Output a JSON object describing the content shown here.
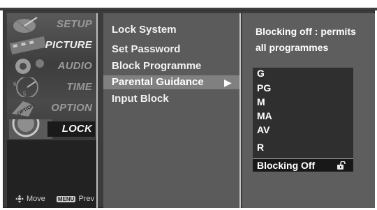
{
  "sidebar": {
    "items": [
      {
        "label": "SETUP",
        "icon": "satellite-dish-icon"
      },
      {
        "label": "PICTURE",
        "icon": "film-strip-icon"
      },
      {
        "label": "AUDIO",
        "icon": "speaker-icon"
      },
      {
        "label": "TIME",
        "icon": "clock-icon"
      },
      {
        "label": "OPTION",
        "icon": "option-icon"
      },
      {
        "label": "LOCK",
        "icon": "lock-dial-icon"
      }
    ],
    "active_index": 5
  },
  "footer": {
    "move_label": "Move",
    "menu_key": "MENU",
    "prev_label": "Prev"
  },
  "submenu": {
    "items": [
      {
        "label": "Lock System"
      },
      {
        "label": "Set Password"
      },
      {
        "label": "Block Programme"
      },
      {
        "label": "Parental Guidance"
      },
      {
        "label": "Input Block"
      }
    ],
    "selected_index": 3,
    "selected_arrow": "▶"
  },
  "panel": {
    "info_line1": "Blocking off : permits",
    "info_line2": "all programmes",
    "ratings": [
      "G",
      "PG",
      "M",
      "MA",
      "AV",
      "R"
    ],
    "blocking_option": "Blocking Off",
    "blocking_icon": "unlock-icon"
  },
  "colors": {
    "frame": "#3c3c3c",
    "sidebar_bg": "#222222",
    "submenu_bg": "#5b5b5b",
    "panel_bg": "#5e5e5e",
    "ratings_bg": "#2f2f2f"
  }
}
